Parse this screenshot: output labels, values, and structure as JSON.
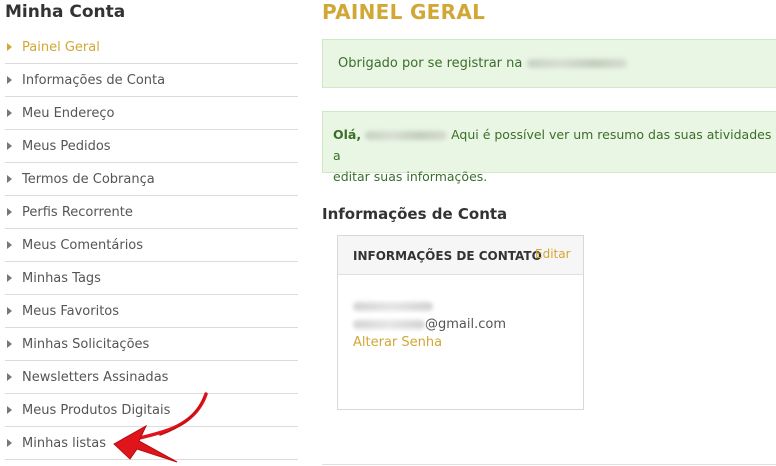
{
  "sidebar": {
    "title": "Minha Conta",
    "items": [
      {
        "label": "Painel Geral",
        "active": true
      },
      {
        "label": "Informações de Conta"
      },
      {
        "label": "Meu Endereço"
      },
      {
        "label": "Meus Pedidos"
      },
      {
        "label": "Termos de Cobrança"
      },
      {
        "label": "Perfis Recorrente"
      },
      {
        "label": "Meus Comentários"
      },
      {
        "label": "Minhas Tags"
      },
      {
        "label": "Meus Favoritos"
      },
      {
        "label": "Minhas Solicitações"
      },
      {
        "label": "Newsletters Assinadas"
      },
      {
        "label": "Meus Produtos Digitais"
      },
      {
        "label": "Minhas listas"
      }
    ]
  },
  "main": {
    "title": "PAINEL GERAL",
    "alert_registered": "Obrigado por se registrar na",
    "alert_hello_prefix": "Olá,",
    "alert_hello_text_1": "Aqui é possível ver um resumo das suas atividades e a",
    "alert_hello_text_2": "editar suas informações.",
    "section_title": "Informações de Conta",
    "contact_box": {
      "title": "INFORMAÇÕES DE CONTATO",
      "edit_label": "Editar",
      "email_suffix": "@gmail.com",
      "change_password_label": "Alterar Senha"
    }
  },
  "colors": {
    "accent": "#d1a736",
    "alert_bg": "#e9f6e4",
    "annotation": "#e0141b"
  },
  "icons": {
    "nav_bullet": "triangle-right-icon",
    "annotation": "red-arrow"
  }
}
